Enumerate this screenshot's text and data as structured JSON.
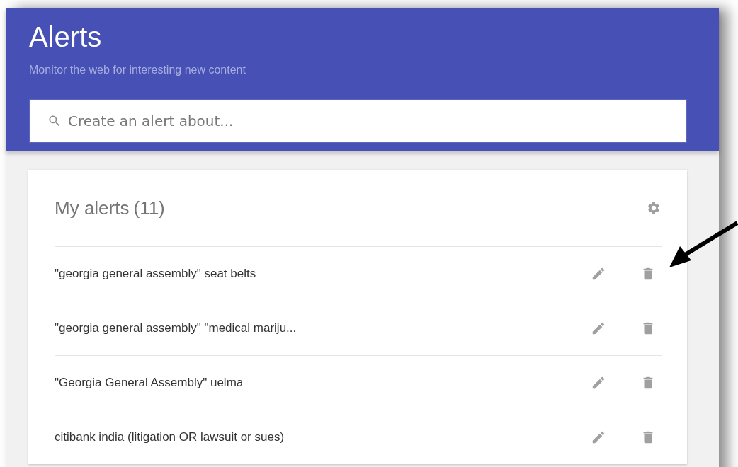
{
  "header": {
    "title": "Alerts",
    "subtitle": "Monitor the web for interesting new content"
  },
  "search": {
    "placeholder": "Create an alert about..."
  },
  "alerts_card": {
    "title": "My alerts",
    "count": "(11)",
    "alerts": [
      {
        "query": "\"georgia general assembly\" seat belts"
      },
      {
        "query": "\"georgia general assembly\" \"medical mariju..."
      },
      {
        "query": "\"Georgia General Assembly\" uelma"
      },
      {
        "query": "citibank india (litigation OR lawsuit or sues)"
      }
    ]
  }
}
